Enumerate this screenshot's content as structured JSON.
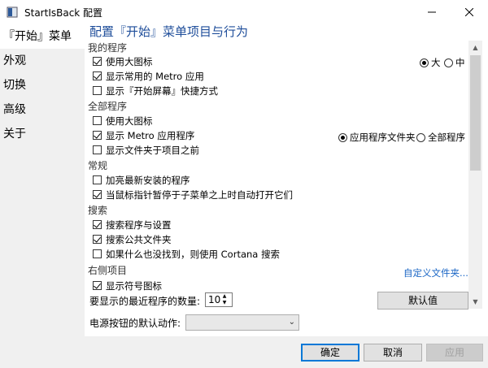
{
  "window": {
    "title": "StartIsBack 配置"
  },
  "sidebar": {
    "items": [
      {
        "label": "『开始』菜单"
      },
      {
        "label": "外观"
      },
      {
        "label": "切换"
      },
      {
        "label": "高级"
      },
      {
        "label": "关于"
      }
    ]
  },
  "main": {
    "heading": "配置『开始』菜单项目与行为",
    "sections": {
      "my_programs": "我的程序",
      "all_programs": "全部程序",
      "general": "常规",
      "search": "搜索",
      "right_items": "右侧项目"
    },
    "options": {
      "use_large_icons": "使用大图标",
      "show_common_metro": "显示常用的 Metro 应用",
      "show_start_screen_shortcut": "显示『开始屏幕』快捷方式",
      "all_use_large_icons": "使用大图标",
      "show_metro_apps": "显示 Metro 应用程序",
      "show_folders_first": "显示文件夹于项目之前",
      "highlight_new": "加亮最新安装的程序",
      "auto_open_submenu": "当鼠标指针暂停于子菜单之上时自动打开它们",
      "search_programs_settings": "搜索程序与设置",
      "search_public_folders": "搜索公共文件夹",
      "cortana_search": "如果什么也没找到，则使用 Cortana 搜索",
      "right_partial": "显示符号图标"
    },
    "radios": {
      "large": "大",
      "medium": "中",
      "app_folder": "应用程序文件夹",
      "all_programs": "全部程序"
    },
    "customize_link": "自定义文件夹...",
    "recent_count_label": "要显示的最近程序的数量:",
    "recent_count_value": "10",
    "default_button": "默认值",
    "power_button_label": "电源按钮的默认动作:",
    "power_button_value": ""
  },
  "footer": {
    "ok": "确定",
    "cancel": "取消",
    "apply": "应用"
  }
}
